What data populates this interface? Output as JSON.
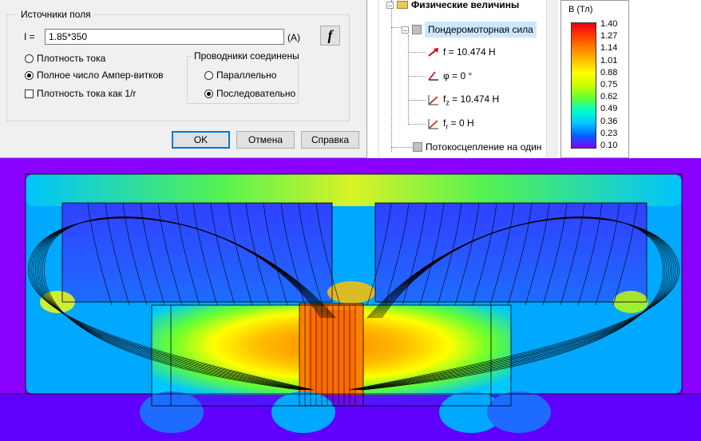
{
  "dialog": {
    "sources_group_label": "Источники поля",
    "current_label": "I =",
    "current_value": "1.85*350",
    "current_unit": "(A)",
    "formula_button": "f",
    "options": {
      "current_density": "Плотность тока",
      "total_ampere_turns": "Полное число Ампер-витков",
      "current_density_1r": "Плотность тока как 1/r"
    },
    "selected_option": "total_ampere_turns",
    "conductors_group_label": "Проводники соединены",
    "connection": {
      "parallel": "Параллельно",
      "series": "Последовательно"
    },
    "selected_connection": "series",
    "buttons": {
      "ok": "OK",
      "cancel": "Отмена",
      "help": "Справка"
    }
  },
  "tree": {
    "physical_quantities": "Физические величины",
    "ponderomotive_force": "Пондеромоторная сила",
    "f_value": "f = 10.474 Н",
    "phi_value": "φ = 0 °",
    "fz_prefix": "f",
    "fz_sub": "z",
    "fz_suffix": " = 10.474 Н",
    "fr_prefix": "f",
    "fr_sub": "r",
    "fr_suffix": " = 0 Н",
    "flux_linkage": "Потокосцепление на один"
  },
  "legend": {
    "title": "B (Тл)",
    "ticks": [
      "1.40",
      "1.27",
      "1.14",
      "1.01",
      "0.88",
      "0.75",
      "0.62",
      "0.49",
      "0.36",
      "0.23",
      "0.10"
    ],
    "colors": [
      "#e8001c",
      "#ff3c00",
      "#ff8000",
      "#ffbf00",
      "#ffff00",
      "#c8ff00",
      "#64ff32",
      "#00ffc8",
      "#00c8ff",
      "#0064ff",
      "#8000ff"
    ]
  },
  "plot": {
    "background_color": "#8a00ff"
  }
}
